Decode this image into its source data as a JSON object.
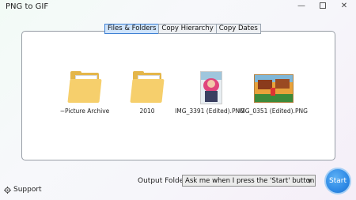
{
  "window": {
    "title": "PNG to GIF",
    "minimize_glyph": "—",
    "close_glyph": "✕"
  },
  "tabs": [
    {
      "label": "Files & Folders",
      "active": true
    },
    {
      "label": "Copy Hierarchy",
      "active": false
    },
    {
      "label": "Copy Dates",
      "active": false
    }
  ],
  "items": [
    {
      "name": "~Picture Archive",
      "icon": "folder-with-document-icon"
    },
    {
      "name": "2010",
      "icon": "folder-icon"
    },
    {
      "name": "IMG_3391 (Edited).PNG",
      "icon": "image-thumbnail"
    },
    {
      "name": "IMG_0351 (Edited).PNG",
      "icon": "image-thumbnail"
    }
  ],
  "footer": {
    "support_label": "Support",
    "output_folder_label": "Output Folder:",
    "output_folder_value": "Ask me when I press the 'Start' button",
    "start_label": "Start"
  },
  "colors": {
    "accent": "#2f8ae6",
    "active_tab": "#cfe4fb",
    "folder": "#f6cf6c"
  }
}
